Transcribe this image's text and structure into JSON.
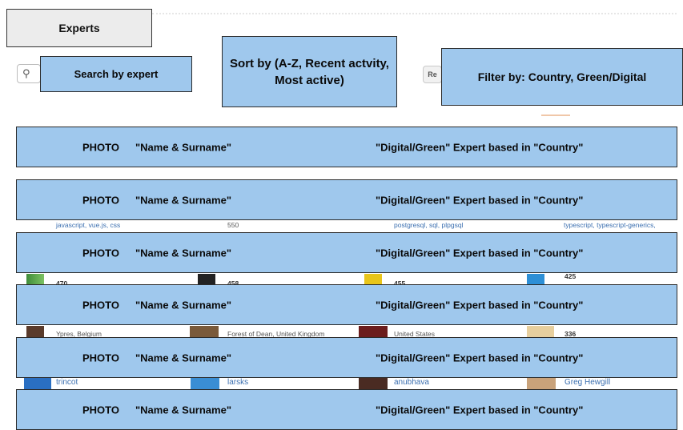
{
  "header": {
    "title": "Experts"
  },
  "search": {
    "icon": "search-icon",
    "label": "Search by expert"
  },
  "sort": {
    "label": "Sort by (A-Z, Recent actvity, Most active)"
  },
  "filter": {
    "chip_label": "Re",
    "label": "Filter by: Country, Green/Digital"
  },
  "expert_rows": [
    {
      "photo": "PHOTO",
      "name": "\"Name & Surname\"",
      "role": "\"Digital/Green\" Expert based in \"Country\""
    },
    {
      "photo": "PHOTO",
      "name": "\"Name & Surname\"",
      "role": "\"Digital/Green\" Expert based in \"Country\""
    },
    {
      "photo": "PHOTO",
      "name": "\"Name & Surname\"",
      "role": "\"Digital/Green\" Expert based in \"Country\""
    },
    {
      "photo": "PHOTO",
      "name": "\"Name & Surname\"",
      "role": "\"Digital/Green\" Expert based in \"Country\""
    },
    {
      "photo": "PHOTO",
      "name": "\"Name & Surname\"",
      "role": "\"Digital/Green\" Expert based in \"Country\""
    },
    {
      "photo": "PHOTO",
      "name": "\"Name & Surname\"",
      "role": "\"Digital/Green\" Expert based in \"Country\""
    }
  ],
  "underlying": {
    "tags_1": "javascript, vue.js, css",
    "count_1": "550",
    "tags_2": "postgresql, sql, plpgsql",
    "tags_3": "typescript, typescript-generics,",
    "count_2": "470",
    "count_3": "458",
    "count_4": "455",
    "count_5": "425",
    "location_1": "Ypres, Belgium",
    "location_2": "Forest of Dean, United Kingdom",
    "location_3": "United States",
    "count_6": "336",
    "user_1": "trincot",
    "user_2": "larsks",
    "user_3": "anubhava",
    "user_4": "Greg Hewgill"
  },
  "colors": {
    "callout_blue": "#9fc8ed",
    "header_gray": "#ececec",
    "link_blue": "#3b6fb0"
  }
}
